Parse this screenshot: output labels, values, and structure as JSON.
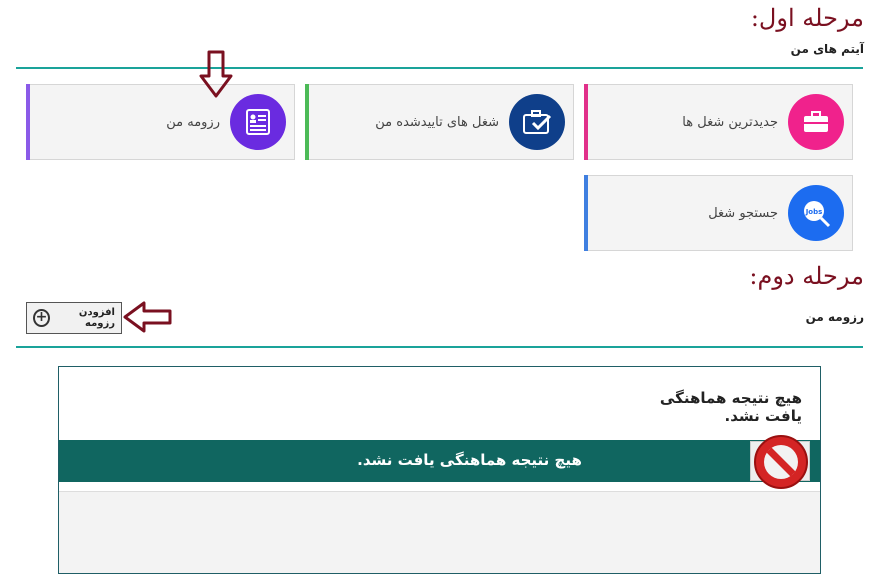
{
  "stage1": {
    "title": "مرحله اول:",
    "section_label": "آیتم های من"
  },
  "cards": [
    {
      "key": "resume",
      "label": "رزومه من",
      "icon": "resume-icon",
      "bar_color": "#8a5ae8",
      "icon_bg": "#6a2be0"
    },
    {
      "key": "approved-jobs",
      "label": "شغل های تاییدشده من",
      "icon": "briefcase-check-icon",
      "bar_color": "#4cba57",
      "icon_bg": "#0f3f8a"
    },
    {
      "key": "latest-jobs",
      "label": "جدیدترین شغل ها",
      "icon": "briefcase-icon",
      "bar_color": "#e1308a",
      "icon_bg": "#f0228c"
    },
    {
      "key": "job-search",
      "label": "جستجو شغل",
      "icon": "jobs-search-icon",
      "icon_text": "Jobs",
      "bar_color": "#3f7fe0",
      "icon_bg": "#1c6cf0"
    }
  ],
  "stage2": {
    "title": "مرحله دوم:",
    "section_label": "رزومه من",
    "add_button_label": "افزودن رزومه"
  },
  "panel": {
    "message": "هیچ نتیجه هماهنگی یافت نشد.",
    "band_message": "هیچ نتیجه هماهنگی یافت نشد."
  },
  "colors": {
    "stage_title": "#7a1020",
    "accent_rule": "#1aa39a",
    "band": "#106660",
    "arrow": "#7a1020"
  }
}
